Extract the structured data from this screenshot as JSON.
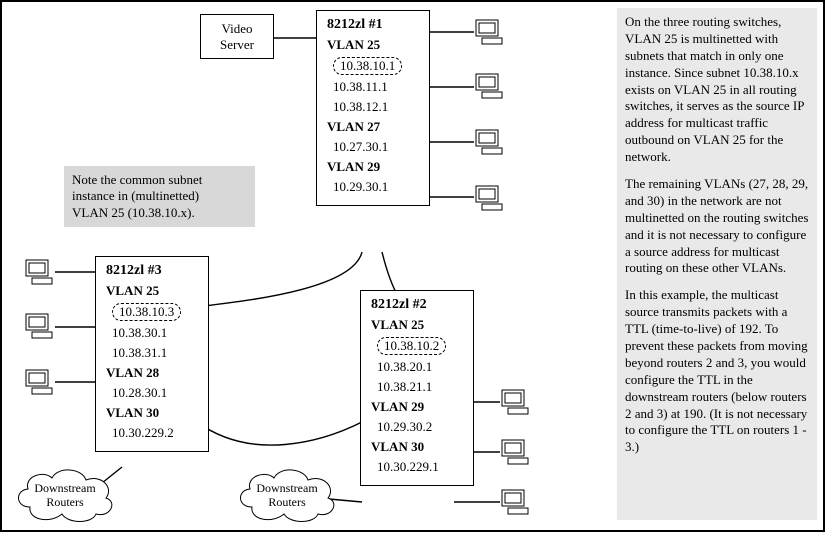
{
  "video_server": {
    "line1": "Video",
    "line2": "Server"
  },
  "note": {
    "line1": "Note the common subnet",
    "line2": "instance in (multinetted)",
    "line3": "VLAN 25 (10.38.10.x)."
  },
  "switch1": {
    "title": "8212zl #1",
    "vlan25_label": "VLAN 25",
    "ip1": "10.38.10.1",
    "ip2": "10.38.11.1",
    "ip3": "10.38.12.1",
    "vlan27_label": "VLAN 27",
    "ip4": "10.27.30.1",
    "vlan29_label": "VLAN 29",
    "ip5": "10.29.30.1"
  },
  "switch2": {
    "title": "8212zl #2",
    "vlan25_label": "VLAN 25",
    "ip1": "10.38.10.2",
    "ip2": "10.38.20.1",
    "ip3": "10.38.21.1",
    "vlan29_label": "VLAN 29",
    "ip4": "10.29.30.2",
    "vlan30_label": "VLAN 30",
    "ip5": "10.30.229.1"
  },
  "switch3": {
    "title": "8212zl #3",
    "vlan25_label": "VLAN 25",
    "ip1": "10.38.10.3",
    "ip2": "10.38.30.1",
    "ip3": "10.38.31.1",
    "vlan28_label": "VLAN 28",
    "ip4": "10.28.30.1",
    "vlan30_label": "VLAN 30",
    "ip5": "10.30.229.2"
  },
  "clouds": {
    "left_line1": "Downstream",
    "left_line2": "Routers",
    "right_line1": "Downstream",
    "right_line2": "Routers"
  },
  "explanation": {
    "p1": "On the three routing switches, VLAN 25 is multinetted with subnets that match in only one instance. Since subnet 10.38.10.x exists on VLAN 25 in all routing switches, it serves as the source IP address for multicast traffic outbound on VLAN 25 for the network.",
    "p2": "The remaining VLANs (27, 28, 29, and 30) in the network are not multinetted on the routing switches and it is not necessary to configure a source address for multicast routing on these other VLANs.",
    "p3": "In this example, the multicast source transmits packets with a TTL (time-to-live) of 192. To prevent these packets from moving beyond routers 2 and 3, you would configure the TTL in the downstream routers (below routers 2 and 3) at 190. (It is not necessary to configure the TTL on routers 1 - 3.)"
  }
}
